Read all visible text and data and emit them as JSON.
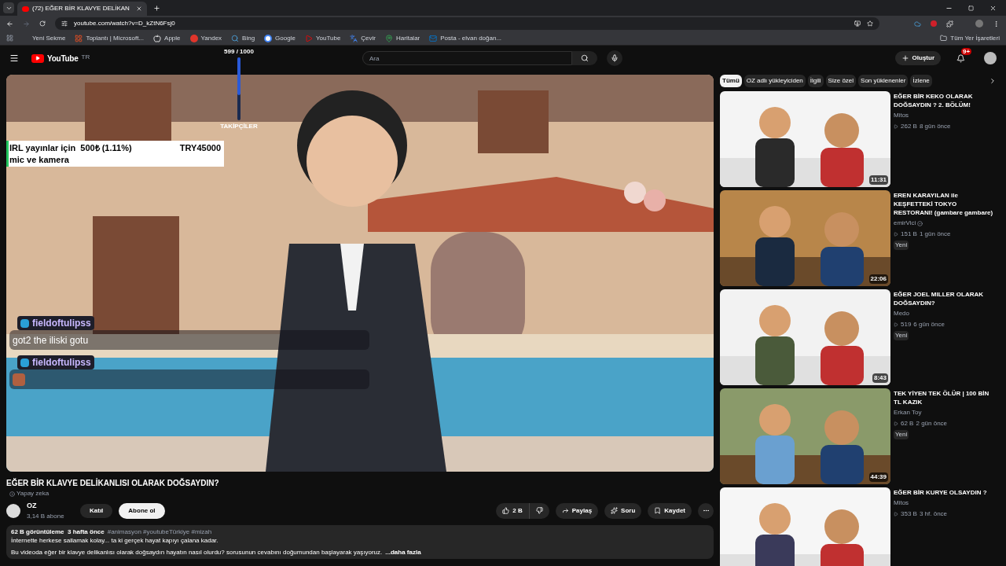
{
  "browser": {
    "tab_title": "(72) EĞER BİR KLAVYE DELİKAN",
    "url": "youtube.com/watch?v=D_kZtN6Fsj0",
    "bookmarks": [
      {
        "label": "Yeni Sekme",
        "kind": "none"
      },
      {
        "label": "Toplantı | Microsoft...",
        "kind": "grid"
      },
      {
        "label": "Apple",
        "kind": "apple"
      },
      {
        "label": "Yandex",
        "kind": "yandex"
      },
      {
        "label": "Bing",
        "kind": "search"
      },
      {
        "label": "Google",
        "kind": "google"
      },
      {
        "label": "YouTube",
        "kind": "youtube"
      },
      {
        "label": "Çevir",
        "kind": "translate"
      },
      {
        "label": "Haritalar",
        "kind": "maps"
      },
      {
        "label": "Posta - elvan doğan...",
        "kind": "mail"
      }
    ],
    "all_bookmarks": "Tüm Yer İşaretleri"
  },
  "header": {
    "logo": "YouTube",
    "country": "TR",
    "search_placeholder": "Ara",
    "create": "Oluştur",
    "notifications": "9+"
  },
  "overlay": {
    "goal": {
      "reading": "599 / 1000",
      "caption": "TAKİPÇİLER",
      "level": 0.599
    },
    "donation": {
      "line1": "IRL yayınlar için  500₺ (1.11%)",
      "amount": "TRY45000",
      "line2": "mic ve kamera",
      "level": 0.0111
    },
    "chat": [
      {
        "user": "fieldoftulipss",
        "kind": "text",
        "message": "got2 the iliski gotu"
      },
      {
        "user": "fieldoftulipss",
        "kind": "emote"
      }
    ]
  },
  "video": {
    "title": "EĞER BİR KLAVYE DELİKANLISI OLARAK DOĞSAYDIN?",
    "ai_label": "Yapay zeka",
    "channel": {
      "name": "OZ",
      "subscribers": "3,14 B abone"
    },
    "join": "Katıl",
    "subscribe": "Abone ol",
    "likes": "2 B",
    "share": "Paylaş",
    "ask": "Soru",
    "save": "Kaydet",
    "description": {
      "stats": "62 B görüntüleme  3 hafta önce",
      "hashtags": "#animasyon #youtubeTürkiye #mizah",
      "line1": "İnternette herkese sallamak kolay... ta ki gerçek hayat kapıyı çalana kadar.",
      "line2": "Bu videoda eğer bir klavye delikanlısı olarak doğsaydın hayatın nasıl olurdu? sorusunun cevabını doğumundan başlayarak yaşıyoruz.",
      "more": "...daha fazla"
    }
  },
  "sidebar": {
    "chips": [
      {
        "label": "Tümü",
        "selected": true
      },
      {
        "label": "OZ adlı yükleyiciden",
        "selected": false
      },
      {
        "label": "İlgili",
        "selected": false
      },
      {
        "label": "Size özel",
        "selected": false
      },
      {
        "label": "Son yüklenenler",
        "selected": false
      },
      {
        "label": "İzlene",
        "selected": false
      }
    ],
    "videos": [
      {
        "title": "EĞER BİR KEKO OLARAK DOĞSAYDIN ? 2. BÖLÜM!",
        "channel": "Mitos",
        "verified": false,
        "views": "262 B",
        "age": "8 gün önce",
        "duration": "11:31"
      },
      {
        "title": "EREN KARAYILAN ile KEŞFETTEKİ TOKYO RESTORANI! (gambare gambare)",
        "channel": "emirVici",
        "verified": true,
        "views": "151 B",
        "age": "1 gün önce",
        "badge": "Yeni",
        "duration": "22:06"
      },
      {
        "title": "EĞER JOEL MILLER OLARAK DOĞSAYDIN?",
        "channel": "Medo",
        "verified": false,
        "views": "519",
        "age": "6 gün önce",
        "badge": "Yeni",
        "duration": "8:43"
      },
      {
        "title": "TEK YİYEN TEK ÖLÜR | 100 BİN TL KAZIK",
        "channel": "Erkan Toy",
        "verified": false,
        "views": "62 B",
        "age": "2 gün önce",
        "badge": "Yeni",
        "duration": "44:39"
      },
      {
        "title": "EĞER BİR KURYE OLSAYDIN ?",
        "channel": "Mitos",
        "verified": false,
        "views": "353 B",
        "age": "3 hf. önce"
      }
    ]
  }
}
